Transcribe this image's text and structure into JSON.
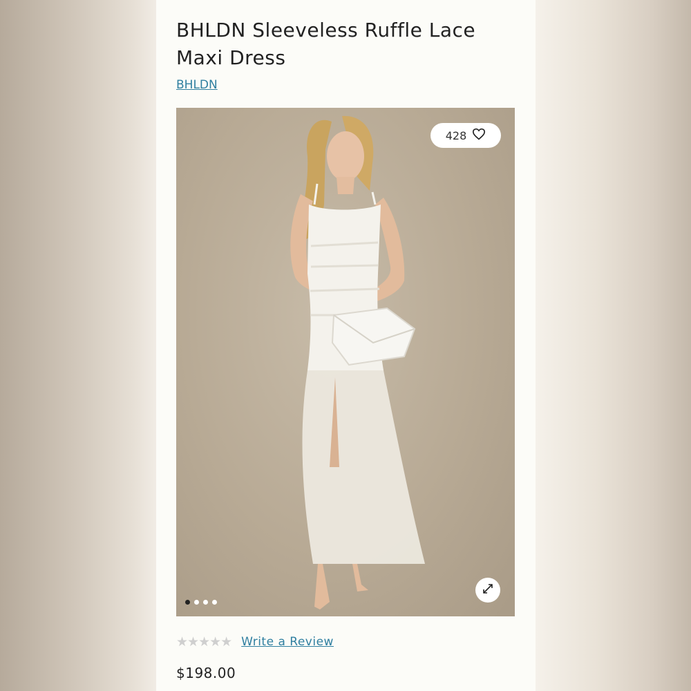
{
  "product": {
    "title": "BHLDN Sleeveless Ruffle Lace Maxi Dress",
    "brand": "BHLDN",
    "likes": "428",
    "image_count": 4,
    "active_image_index": 0,
    "rating_stars": "★★★★★",
    "rating_value": 0,
    "review_link": "Write a Review",
    "price": "$198.00"
  },
  "colors": {
    "link": "#2f7fa0",
    "panel_bg": "#fcfcf8",
    "photo_bg": "#b8aa95"
  },
  "icons": {
    "like": "heart-icon",
    "expand": "expand-arrows-icon"
  }
}
